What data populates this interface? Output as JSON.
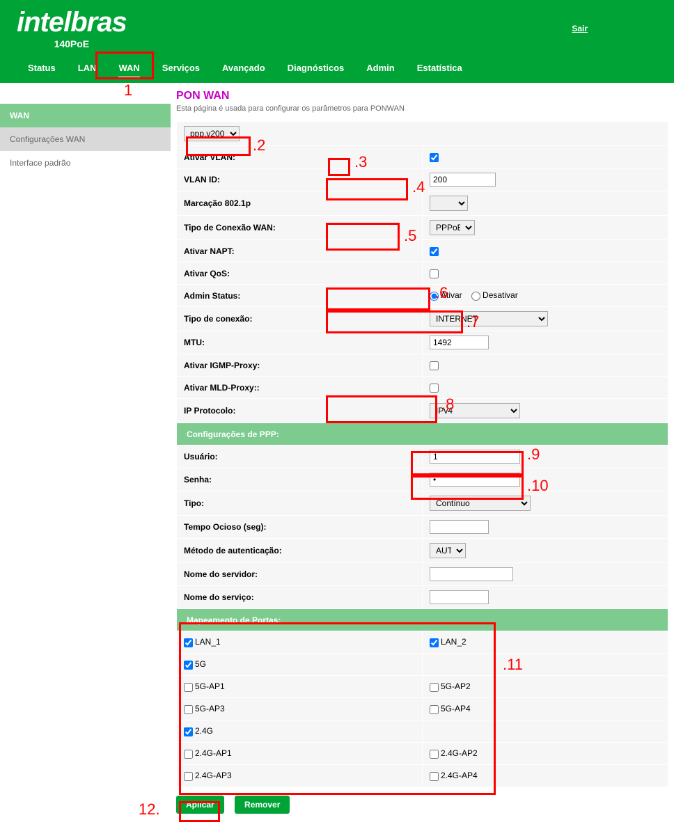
{
  "header": {
    "logo_main": "intelbras",
    "logo_sub": "140PoE",
    "logout": "Sair"
  },
  "nav": [
    "Status",
    "LAN",
    "WAN",
    "Serviços",
    "Avançado",
    "Diagnósticos",
    "Admin",
    "Estatística"
  ],
  "nav_active": 2,
  "sidebar": {
    "section": "WAN",
    "items": [
      "Configurações WAN",
      "Interface padrão"
    ]
  },
  "page": {
    "title": "PON WAN",
    "subtitle": "Esta página é usada para configurar os parâmetros para PONWAN"
  },
  "form": {
    "profile_value": "ppp.v200",
    "vlan_enable_label": "Ativar VLAN:",
    "vlan_enable": true,
    "vlan_id_label": "VLAN ID:",
    "vlan_id": "200",
    "mark8021p_label": "Marcação 802.1p",
    "wan_conn_type_label": "Tipo de Conexão WAN:",
    "wan_conn_type": "PPPoE",
    "napt_label": "Ativar NAPT:",
    "napt": true,
    "qos_label": "Ativar QoS:",
    "qos": false,
    "admin_status_label": "Admin Status:",
    "admin_status_on": "Ativar",
    "admin_status_off": "Desativar",
    "conn_type_label": "Tipo de conexão:",
    "conn_type": "INTERNET",
    "mtu_label": "MTU:",
    "mtu": "1492",
    "igmp_label": "Ativar IGMP-Proxy:",
    "igmp": false,
    "mld_label": "Ativar MLD-Proxy::",
    "mld": false,
    "ipproto_label": "IP Protocolo:",
    "ipproto": "IPv4"
  },
  "ppp": {
    "header": "Configurações de PPP:",
    "user_label": "Usuário:",
    "user": "1",
    "pass_label": "Senha:",
    "pass": "•",
    "type_label": "Tipo:",
    "type": "Contínuo",
    "idle_label": "Tempo Ocioso (seg):",
    "idle": "",
    "auth_label": "Método de autenticação:",
    "auth": "AUTO",
    "server_label": "Nome do servidor:",
    "server": "",
    "service_label": "Nome do serviço:",
    "service": ""
  },
  "portmap": {
    "header": "Mapeamento de Portas:",
    "rows": [
      [
        "LAN_1",
        true,
        "LAN_2",
        true
      ],
      [
        "5G",
        true,
        "",
        null
      ],
      [
        "5G-AP1",
        false,
        "5G-AP2",
        false
      ],
      [
        "5G-AP3",
        false,
        "5G-AP4",
        false
      ],
      [
        "2.4G",
        true,
        "",
        null
      ],
      [
        "2.4G-AP1",
        false,
        "2.4G-AP2",
        false
      ],
      [
        "2.4G-AP3",
        false,
        "2.4G-AP4",
        false
      ]
    ]
  },
  "buttons": {
    "apply": "Aplicar",
    "remove": "Remover"
  },
  "callouts": {
    "1": "1",
    "2": ".2",
    "3": ".3",
    "4": ".4",
    "5": ".5",
    "6": ".6",
    "7": ".7",
    "8": ".8",
    "9": ".9",
    "10": ".10",
    "11": ".11",
    "12": "12."
  }
}
